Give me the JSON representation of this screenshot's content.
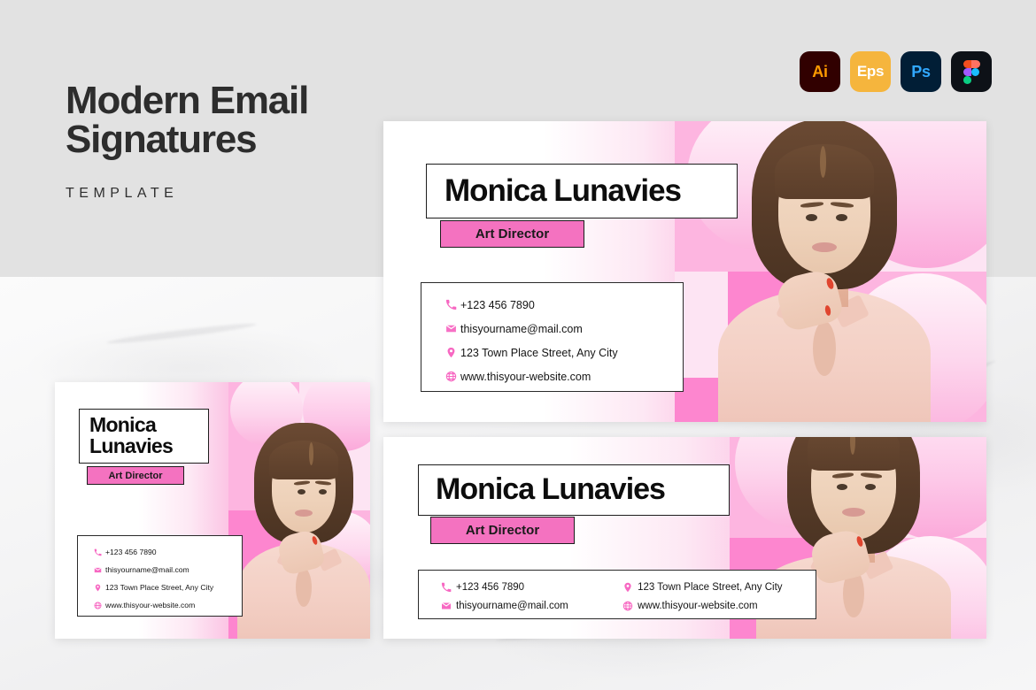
{
  "header": {
    "title": "Modern Email\nSignatures",
    "subtitle": "TEMPLATE"
  },
  "format_badges": [
    {
      "label": "Ai",
      "icon": "illustrator-icon",
      "bg": "#310000",
      "fg": "#ff9a00"
    },
    {
      "label": "Eps",
      "icon": "eps-icon",
      "bg": "#f5b53d",
      "fg": "#ffffff"
    },
    {
      "label": "Ps",
      "icon": "photoshop-icon",
      "bg": "#011e36",
      "fg": "#31a8ff"
    },
    {
      "label": "",
      "icon": "figma-icon",
      "bg": "#0d1117",
      "fg": "#f24e1e"
    }
  ],
  "signature": {
    "name": "Monica Lunavies",
    "name_stacked": "Monica\nLunavies",
    "role": "Art Director",
    "contacts": [
      {
        "icon": "phone-icon",
        "value": "+123 456 7890"
      },
      {
        "icon": "email-icon",
        "value": "thisyourname@mail.com"
      },
      {
        "icon": "location-icon",
        "value": "123 Town Place Street, Any City"
      },
      {
        "icon": "globe-icon",
        "value": "www.thisyour-website.com"
      }
    ]
  },
  "colors": {
    "accent_pink": "#fb67c0",
    "role_pink": "#f472c0",
    "icon_pink": "#f768c2",
    "text_dark": "#0d0d0d",
    "band_gray": "#e2e2e2"
  }
}
